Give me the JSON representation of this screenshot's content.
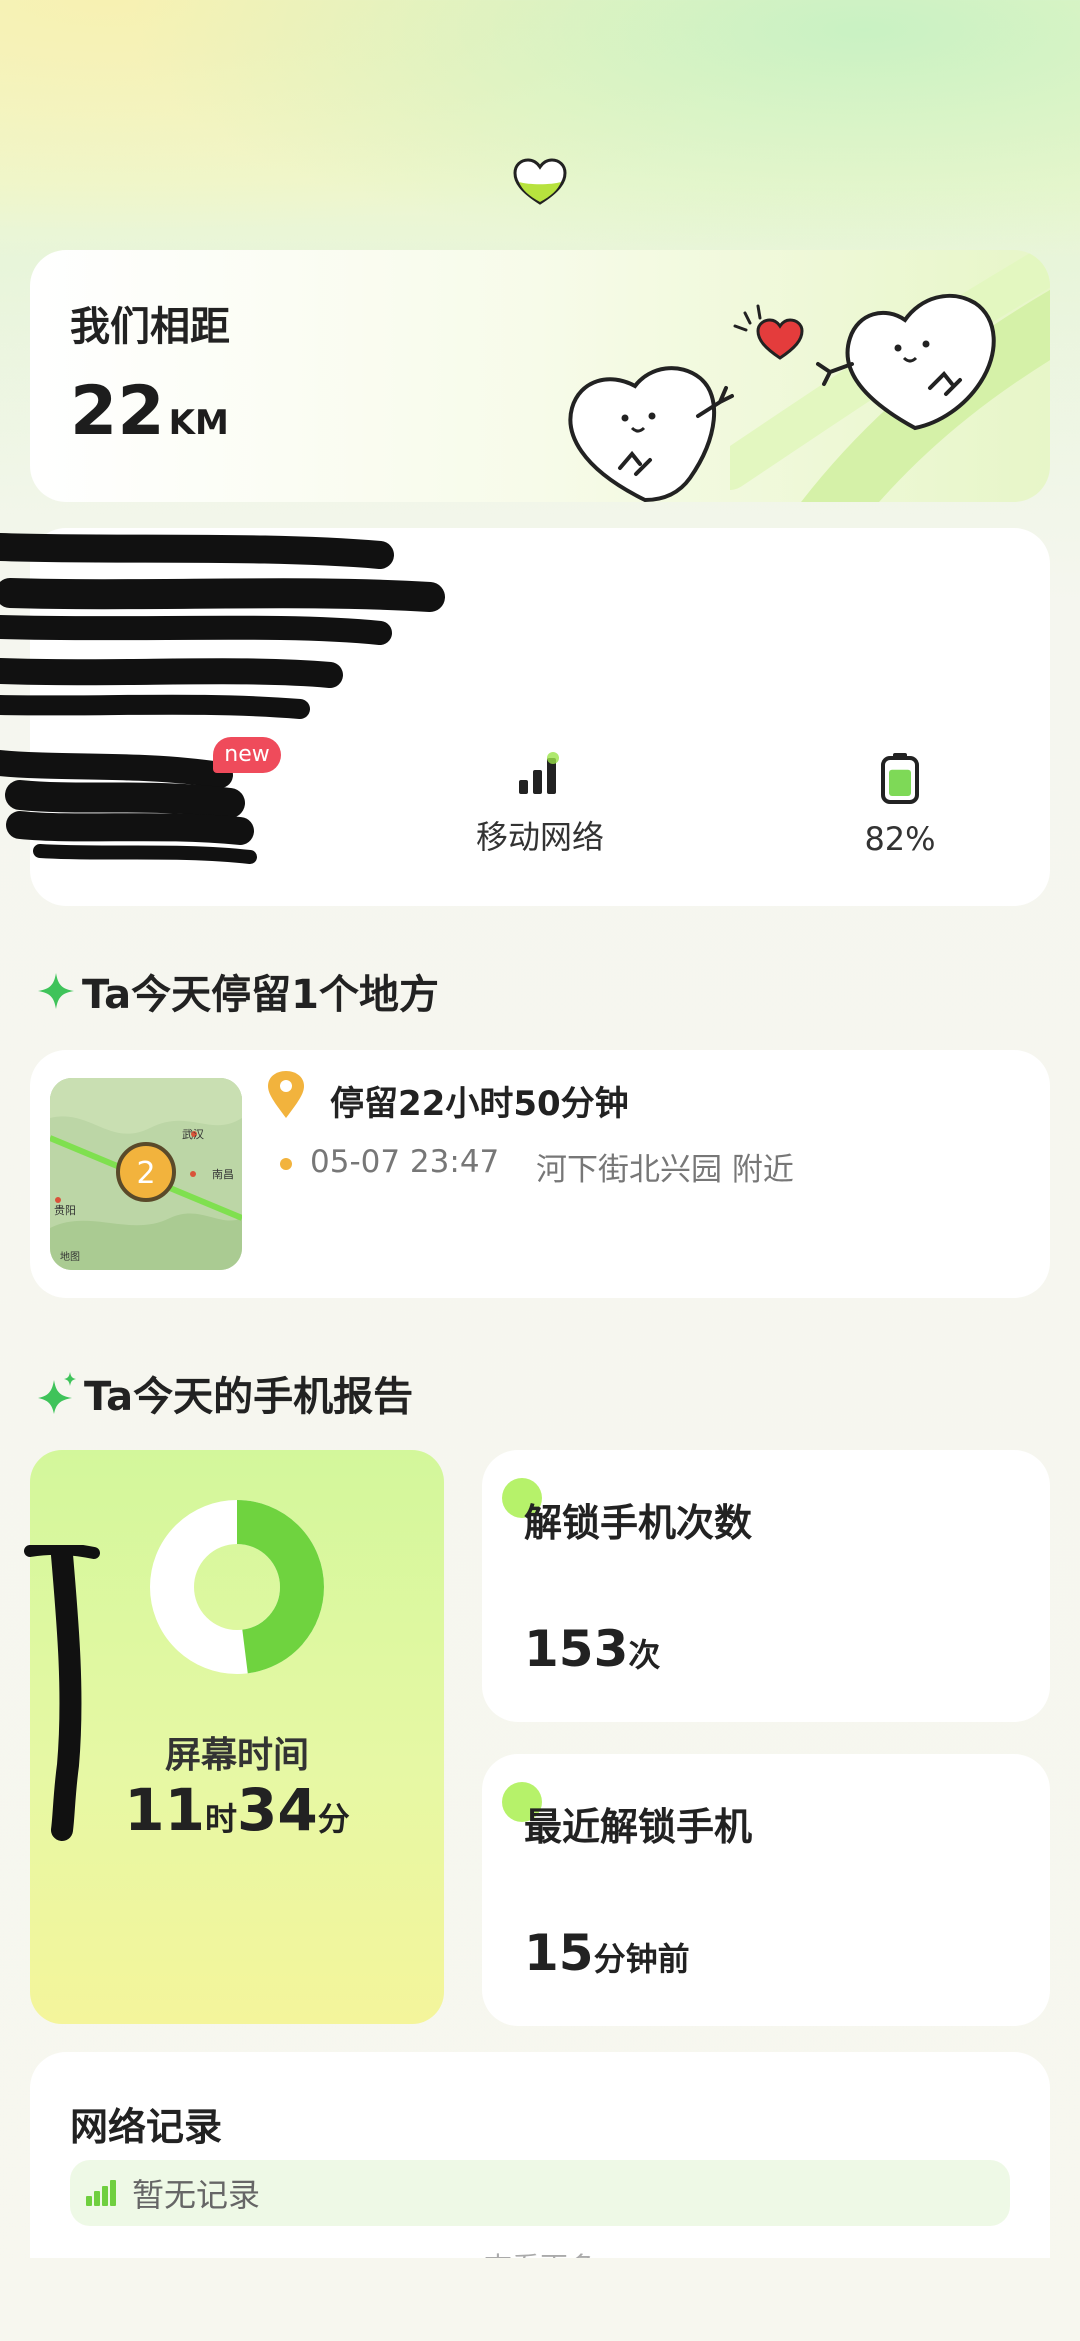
{
  "distance": {
    "label": "我们相距",
    "value": "22",
    "unit": "KM"
  },
  "status": {
    "badge": "new",
    "network_label": "移动网络",
    "battery_label": "82%",
    "battery_level": 0.82
  },
  "places": {
    "title": "Ta今天停留1个地方",
    "count_marker": "2",
    "map_city_1": "武汉",
    "map_city_2": "南昌",
    "map_city_3": "贵阳",
    "map_watermark": "地图",
    "stay_duration": "停留22小时50分钟",
    "time": "05-07 23:47",
    "address": "河下街北兴园 附近"
  },
  "report": {
    "title": "Ta今天的手机报告",
    "screen_time_label": "屏幕时间",
    "screen_hours": "11",
    "screen_hours_unit": "时",
    "screen_minutes": "34",
    "screen_minutes_unit": "分",
    "screen_ring_fraction": 0.48,
    "unlock_count_label": "解锁手机次数",
    "unlock_count": "153",
    "unlock_count_unit": "次",
    "recent_unlock_label": "最近解锁手机",
    "recent_unlock_value": "15",
    "recent_unlock_unit": "分钟前"
  },
  "network_record": {
    "title": "网络记录",
    "empty_text": "暂无记录",
    "see_more": "查看更多"
  },
  "colors": {
    "accent_green": "#7ed957",
    "pin_orange": "#f2b33d",
    "badge_red": "#ef4b5b",
    "heart_red": "#e43c3c"
  }
}
